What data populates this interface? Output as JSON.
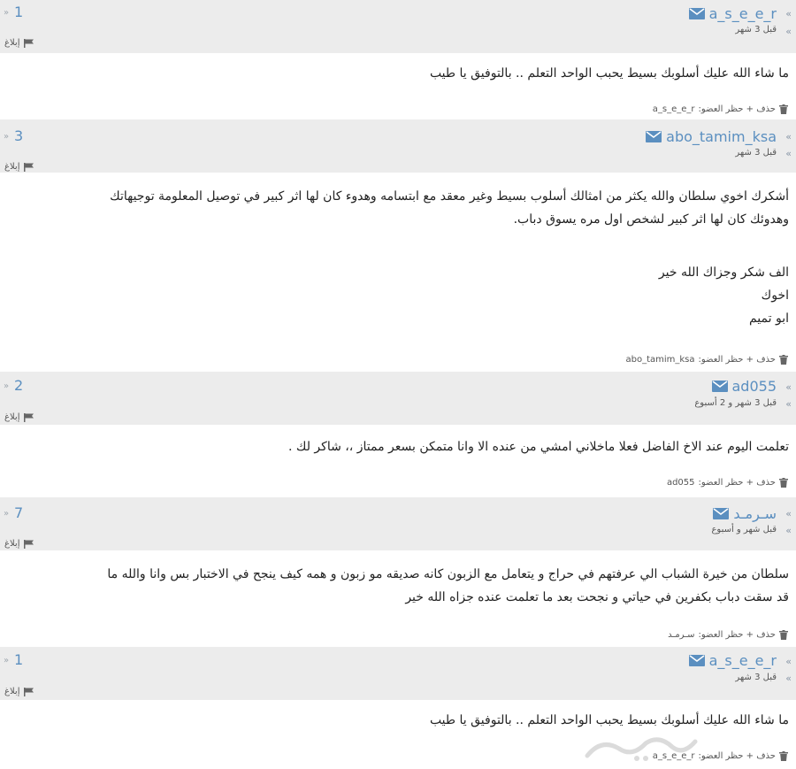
{
  "comments": [
    {
      "username": "a_s_e_e_r",
      "time": "قبل 3 شهر",
      "number": "1",
      "report": "إبلاغ",
      "lines": [
        "ما شاء الله عليك أسلوبك بسيط يحبب الواحد التعلم .. بالتوفيق يا طيب"
      ],
      "actions": "حذف + حظر العضو:",
      "footer_user": "a_s_e_e_r"
    },
    {
      "username": "abo_tamim_ksa",
      "time": "قبل 3 شهر",
      "number": "3",
      "report": "إبلاغ",
      "lines": [
        "أشكرك اخوي سلطان والله يكثر من امثالك أسلوب بسيط وغير معقد مع ابتسامه وهدوء كان لها اثر كبير في توصيل المعلومة توجيهاتك",
        "وهدوئك كان لها اثر كبير لشخص اول مره يسوق دباب.",
        "",
        "الف شكر وجزاك الله خير",
        "اخوك",
        "ابو تميم"
      ],
      "actions": "حذف + حظر العضو:",
      "footer_user": "abo_tamim_ksa"
    },
    {
      "username": "ad055",
      "time": "قبل 3 شهر و 2 أسبوع",
      "number": "2",
      "report": "إبلاغ",
      "lines": [
        "تعلمت اليوم عند الاخ الفاضل فعلا ماخلاني امشي من عنده الا وانا متمكن بسعر ممتاز ،، شاكر لك ."
      ],
      "actions": "حذف + حظر العضو:",
      "footer_user": "ad055"
    },
    {
      "username": "سـرمـد",
      "time": "قبل شهر و أسبوع",
      "number": "7",
      "report": "إبلاغ",
      "lines": [
        "سلطان من خيرة الشباب الي عرفتهم في حراج و يتعامل مع الزبون كانه صديقه مو زبون و همه كيف ينجح في الاختبار بس وانا والله ما",
        "قد سقت دباب بكفرين في حياتي و نجحت بعد ما تعلمت عنده جزاه الله خير"
      ],
      "actions": "حذف + حظر العضو:",
      "footer_user": "سـرمـد"
    },
    {
      "username": "a_s_e_e_r",
      "time": "قبل 3 شهر",
      "number": "1",
      "report": "إبلاغ",
      "lines": [
        "ما شاء الله عليك أسلوبك بسيط يحبب الواحد التعلم .. بالتوفيق يا طيب"
      ],
      "actions": "حذف + حظر العضو:",
      "footer_user": "a_s_e_e_r"
    }
  ],
  "icons": {
    "message": "envelope-icon",
    "report": "flag-icon",
    "delete": "trash-icon",
    "quote": "double-chevron-icon"
  },
  "colors": {
    "accent": "#5b8fc0",
    "header_bg": "#ececec",
    "text": "#222222"
  }
}
